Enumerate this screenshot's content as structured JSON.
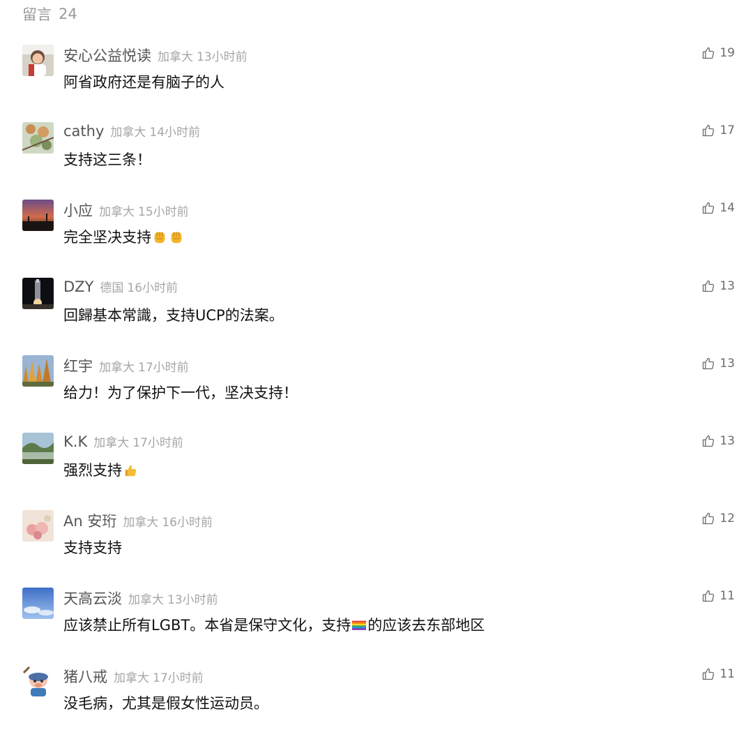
{
  "header": {
    "title": "留言",
    "count": "24"
  },
  "comments": [
    {
      "name": "安心公益悦读",
      "region": "加拿大",
      "time": "13小时前",
      "text": "阿省政府还是有脑子的人",
      "likes": "19"
    },
    {
      "name": "cathy",
      "region": "加拿大",
      "time": "14小时前",
      "text": "支持这三条！",
      "likes": "17"
    },
    {
      "name": "小应",
      "region": "加拿大",
      "time": "15小时前",
      "text": "完全坚决支持",
      "emojis": [
        "raised-fist",
        "raised-fist"
      ],
      "likes": "14"
    },
    {
      "name": "DZY",
      "region": "德国",
      "time": "16小时前",
      "text": "回歸基本常識，支持UCP的法案。",
      "likes": "13"
    },
    {
      "name": "红宇",
      "region": "加拿大",
      "time": "17小时前",
      "text": "给力！为了保护下一代，坚决支持！",
      "likes": "13"
    },
    {
      "name": "K.K",
      "region": "加拿大",
      "time": "17小时前",
      "text": "强烈支持",
      "emojis": [
        "thumbs-up"
      ],
      "likes": "13"
    },
    {
      "name": "An 安珩",
      "region": "加拿大",
      "time": "16小时前",
      "text": "支持支持",
      "likes": "12"
    },
    {
      "name": "天高云淡",
      "region": "加拿大",
      "time": "13小时前",
      "text_before": "应该禁止所有LGBT。本省是保守文化，支持",
      "emoji_mid": "rainbow-flag",
      "text_after": "的应该去东部地区",
      "likes": "11"
    },
    {
      "name": "猪八戒",
      "region": "加拿大",
      "time": "17小时前",
      "text": "没毛病，尤其是假女性运动员。",
      "likes": "11"
    }
  ],
  "icons": {
    "like": "thumbs-up-outline-icon"
  },
  "colors": {
    "header": "#9a9a9a",
    "name": "#545454",
    "meta": "#a6a6a6",
    "text": "#111111",
    "like": "#6c6c6c"
  }
}
